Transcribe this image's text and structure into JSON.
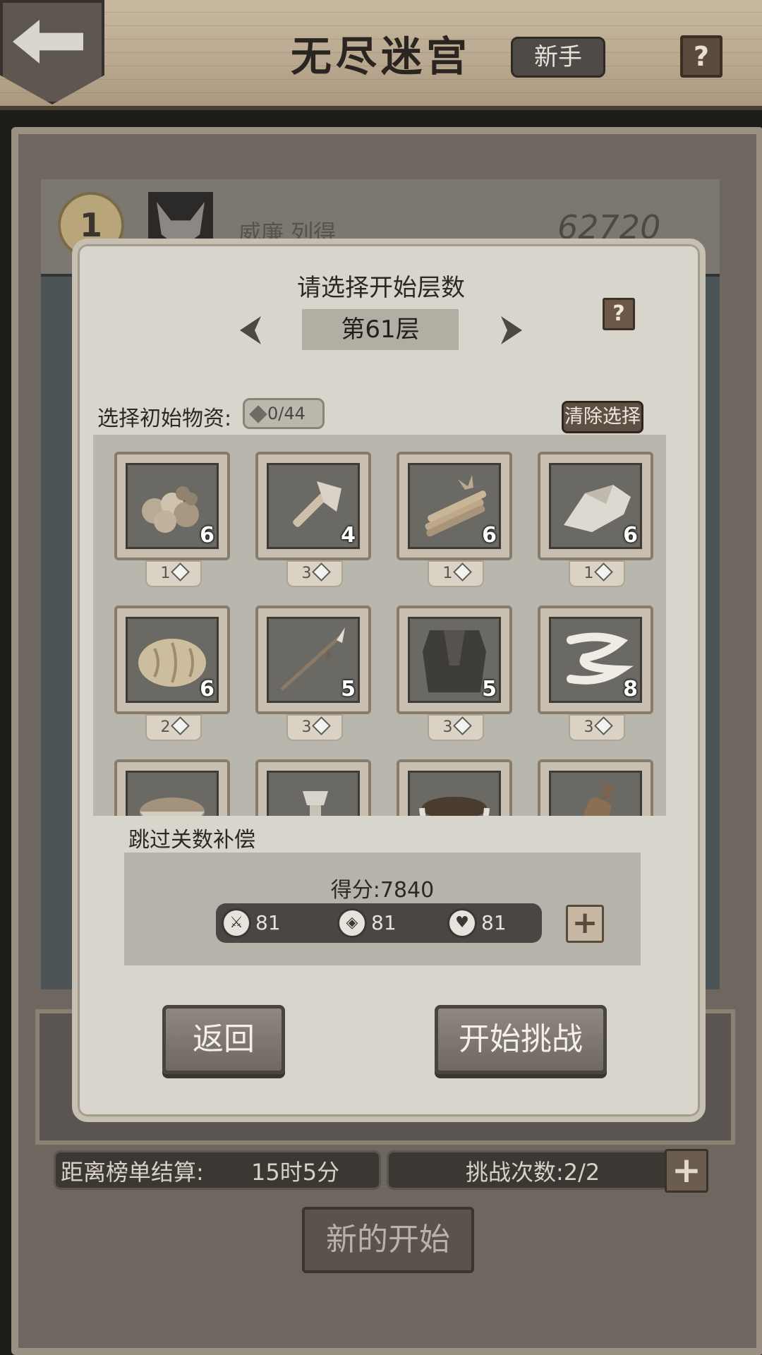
{
  "header": {
    "title": "无尽迷宫",
    "mode_badge": "新手",
    "help": "?"
  },
  "background": {
    "top_rank": {
      "rank": "1",
      "name": "威廉 列得",
      "score": "62720"
    },
    "settlement_label": "距离榜单结算:",
    "settlement_time": "15时5分",
    "attempts_label": "挑战次数:2/2",
    "new_start_label": "新的开始"
  },
  "modal": {
    "title": "请选择开始层数",
    "help": "?",
    "floor": "第61层",
    "supply_label": "选择初始物资:",
    "supply_counter": "0/44",
    "clear_label": "清除选择",
    "items": [
      {
        "icon": "berries-icon",
        "count": "6",
        "cost": "1"
      },
      {
        "icon": "axe-icon",
        "count": "4",
        "cost": "3"
      },
      {
        "icon": "firewood-icon",
        "count": "6",
        "cost": "1"
      },
      {
        "icon": "stone-icon",
        "count": "6",
        "cost": "1"
      },
      {
        "icon": "bread-icon",
        "count": "6",
        "cost": "2"
      },
      {
        "icon": "spear-icon",
        "count": "5",
        "cost": "3"
      },
      {
        "icon": "cloak-icon",
        "count": "5",
        "cost": "3"
      },
      {
        "icon": "bandage-icon",
        "count": "8",
        "cost": "3"
      },
      {
        "icon": "flour-bowl-icon",
        "count": "",
        "cost": ""
      },
      {
        "icon": "hammer-icon",
        "count": "",
        "cost": ""
      },
      {
        "icon": "soup-bowl-icon",
        "count": "",
        "cost": ""
      },
      {
        "icon": "bottle-icon",
        "count": "",
        "cost": ""
      }
    ],
    "compensation_label": "跳过关数补偿",
    "score_text": "得分:7840",
    "stats": {
      "attack": "81",
      "defense": "81",
      "health": "81"
    },
    "back_label": "返回",
    "start_label": "开始挑战"
  }
}
